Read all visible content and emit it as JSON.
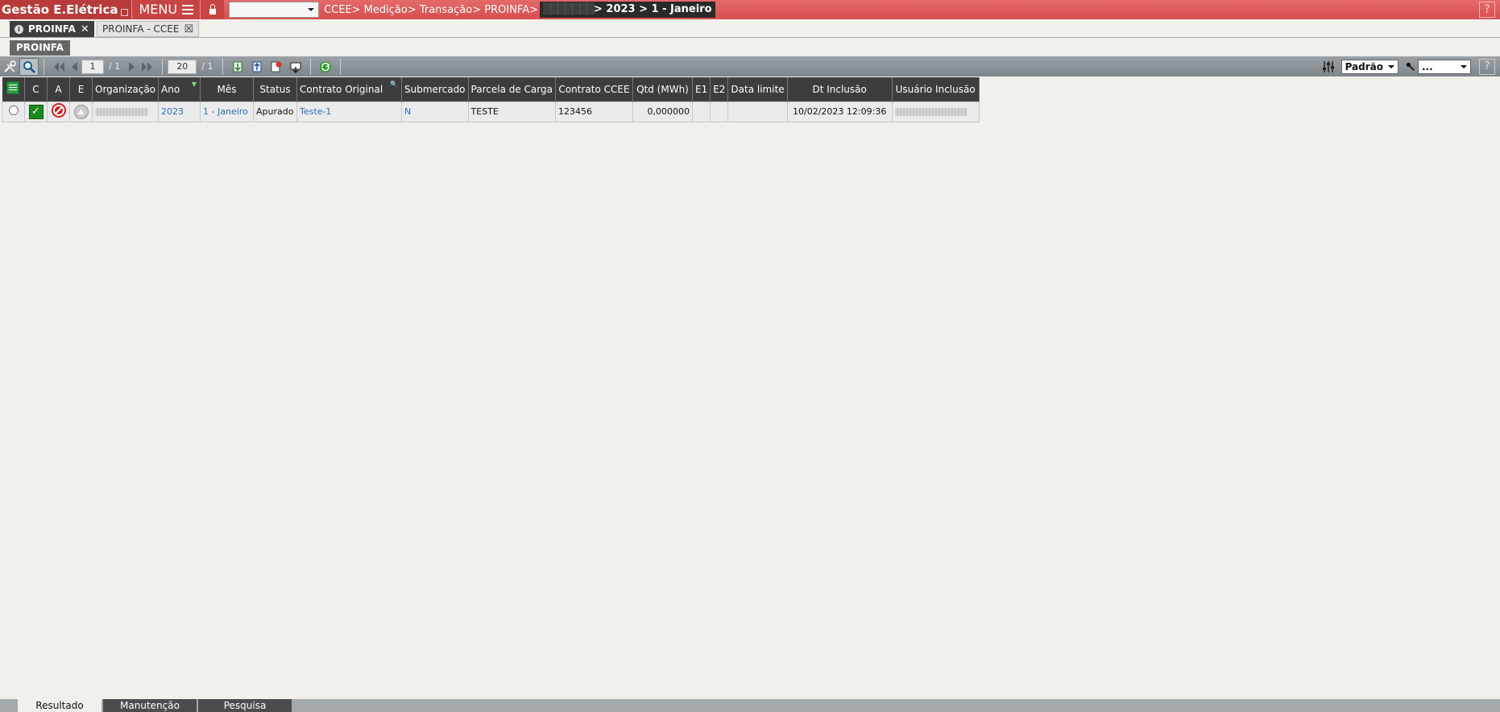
{
  "app": {
    "title": "Gestão E.Elétrica",
    "menu_label": "MENU"
  },
  "breadcrumb": {
    "path": "CCEE> Medição> Transação> PROINFA>",
    "highlight": "> 2023 > 1 - Janeiro"
  },
  "tabs": [
    {
      "label": "PROINFA",
      "close": "✕"
    },
    {
      "label": "PROINFA - CCEE",
      "close": "☒"
    }
  ],
  "subtab": {
    "label": "PROINFA"
  },
  "toolbar": {
    "page_current": "1",
    "page_total": "/ 1",
    "page_size": "20",
    "page_size_total": "/ 1",
    "view_select": "Padrão",
    "filter_select": "..."
  },
  "help": "?",
  "grid": {
    "columns": [
      "C",
      "A",
      "E",
      "Organização",
      "Ano",
      "Mês",
      "Status",
      "Contrato Original",
      "Submercado",
      "Parcela de Carga",
      "Contrato CCEE",
      "Qtd (MWh)",
      "E1",
      "E2",
      "Data limite",
      "Dt Inclusão",
      "Usuário Inclusão"
    ],
    "rows": [
      {
        "ano": "2023",
        "mes": "1 - Janeiro",
        "status": "Apurado",
        "contrato_original": "Teste-1",
        "submercado": "N",
        "parcela_carga": "TESTE",
        "contrato_ccee": "123456",
        "qtd": "0,000000",
        "e1": "",
        "e2": "",
        "data_limite": "",
        "dt_inclusao": "10/02/2023 12:09:36"
      }
    ]
  },
  "bottom_tabs": [
    "Resultado",
    "Manutenção",
    "Pesquisa"
  ],
  "colors": {
    "topbar": "#d84e4e",
    "header": "#3d3d3d",
    "link": "#2d6fc4",
    "background": "#f1f0eb"
  }
}
